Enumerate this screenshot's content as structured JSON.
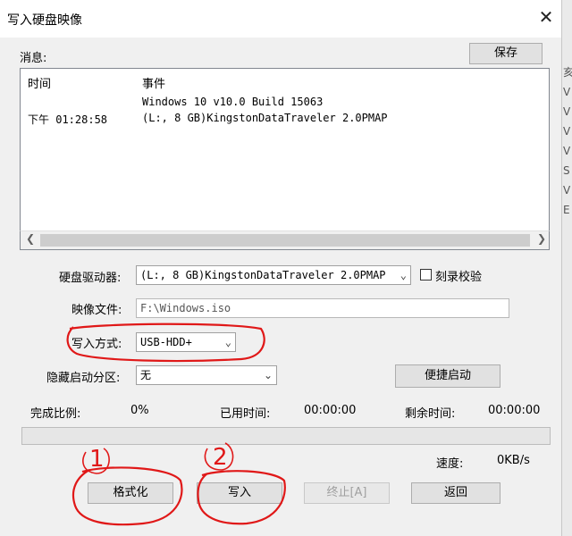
{
  "window": {
    "title": "写入硬盘映像",
    "close_glyph": "✕"
  },
  "messages": {
    "label": "消息:",
    "save_label": "保存",
    "col_time": "时间",
    "col_event": "事件",
    "rows": [
      {
        "time": "",
        "event": "Windows 10 v10.0 Build 15063"
      },
      {
        "time": "下午 01:28:58",
        "event": "(L:, 8 GB)KingstonDataTraveler 2.0PMAP"
      }
    ]
  },
  "form": {
    "drive_label": "硬盘驱动器:",
    "drive_value": "(L:, 8 GB)KingstonDataTraveler 2.0PMAP",
    "verify_label": "刻录校验",
    "verify_checked": false,
    "image_label": "映像文件:",
    "image_value": "F:\\Windows.iso",
    "write_mode_label": "写入方式:",
    "write_mode_value": "USB-HDD+",
    "hidden_part_label": "隐藏启动分区:",
    "hidden_part_value": "无",
    "quick_boot_label": "便捷启动"
  },
  "status": {
    "percent_label": "完成比例:",
    "percent_value": "0%",
    "elapsed_label": "已用时间:",
    "elapsed_value": "00:00:00",
    "remaining_label": "剩余时间:",
    "remaining_value": "00:00:00",
    "progress": 0,
    "speed_label": "速度:",
    "speed_value": "0KB/s"
  },
  "actions": {
    "format_label": "格式化",
    "write_label": "写入",
    "stop_label": "终止[A]",
    "back_label": "返回"
  },
  "annotations": {
    "mark1": "1",
    "mark2": "2",
    "color": "#e01818"
  },
  "background_glyphs": [
    "亥",
    "V",
    "V",
    "V",
    "V",
    "S",
    "V",
    "E"
  ]
}
